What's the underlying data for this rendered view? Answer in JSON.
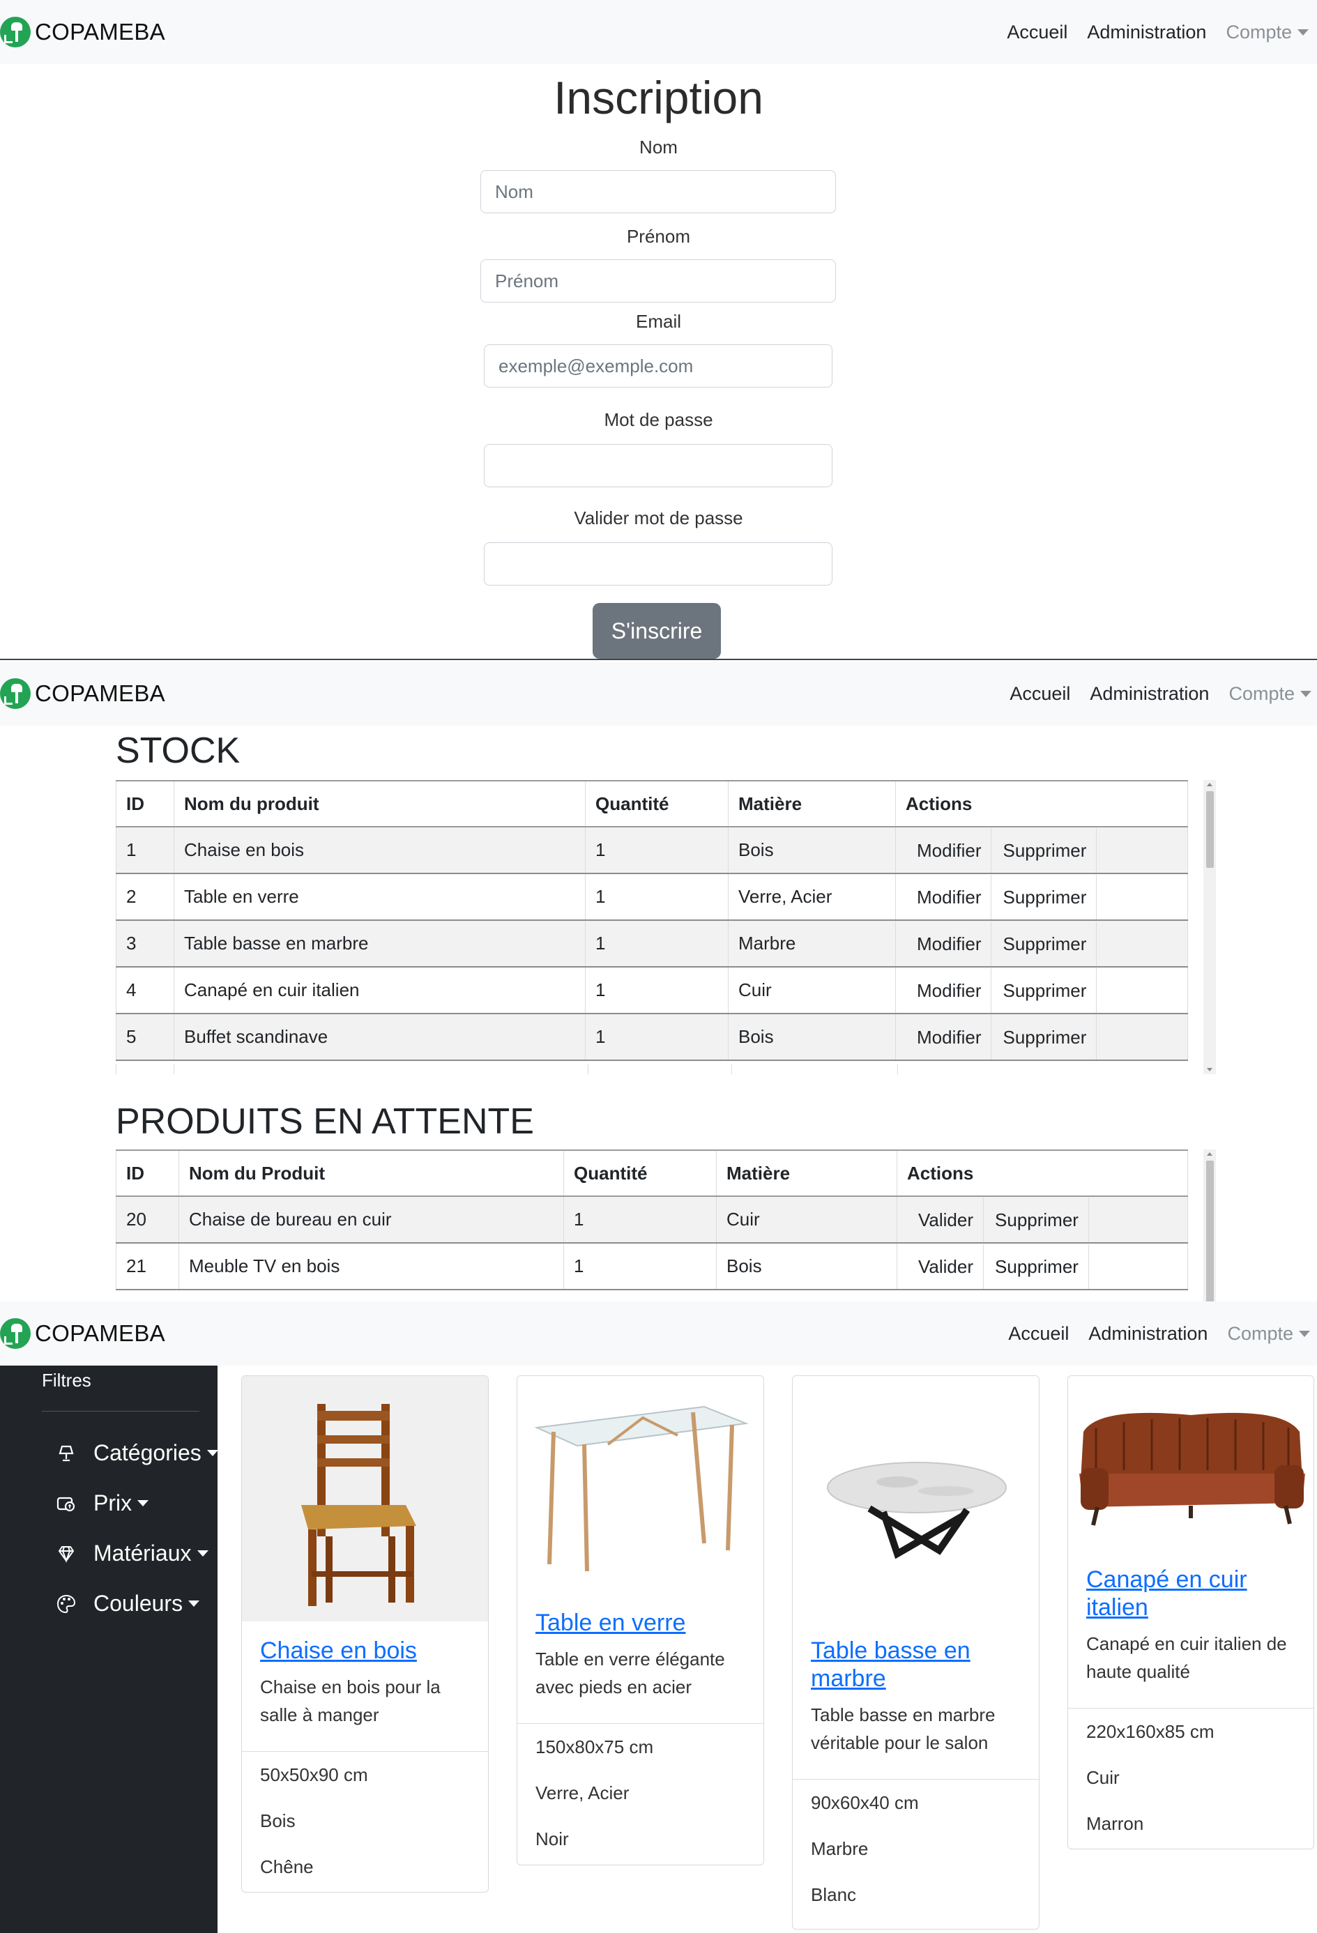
{
  "navbar": {
    "brand": "COPAMEBA",
    "links": {
      "home": "Accueil",
      "admin": "Administration",
      "account": "Compte"
    }
  },
  "inscription": {
    "title": "Inscription",
    "fields": {
      "nom": {
        "label": "Nom",
        "placeholder": "Nom"
      },
      "prenom": {
        "label": "Prénom",
        "placeholder": "Prénom"
      },
      "email": {
        "label": "Email",
        "placeholder": "exemple@exemple.com"
      },
      "password": {
        "label": "Mot de passe",
        "placeholder": ""
      },
      "confirm": {
        "label": "Valider mot de passe",
        "placeholder": ""
      }
    },
    "submit": "S'inscrire"
  },
  "stock": {
    "title": "STOCK",
    "headers": {
      "id": "ID",
      "name": "Nom du produit",
      "qty": "Quantité",
      "material": "Matière",
      "actions": "Actions"
    },
    "action_labels": {
      "edit": "Modifier",
      "delete": "Supprimer"
    },
    "rows": [
      {
        "id": "1",
        "name": "Chaise en bois",
        "qty": "1",
        "material": "Bois"
      },
      {
        "id": "2",
        "name": "Table en verre",
        "qty": "1",
        "material": "Verre, Acier"
      },
      {
        "id": "3",
        "name": "Table basse en marbre",
        "qty": "1",
        "material": "Marbre"
      },
      {
        "id": "4",
        "name": "Canapé en cuir italien",
        "qty": "1",
        "material": "Cuir"
      },
      {
        "id": "5",
        "name": "Buffet scandinave",
        "qty": "1",
        "material": "Bois"
      }
    ]
  },
  "pending": {
    "title": "PRODUITS EN ATTENTE",
    "headers": {
      "id": "ID",
      "name": "Nom du Produit",
      "qty": "Quantité",
      "material": "Matière",
      "actions": "Actions"
    },
    "action_labels": {
      "validate": "Valider",
      "delete": "Supprimer"
    },
    "rows": [
      {
        "id": "20",
        "name": "Chaise de bureau en cuir",
        "qty": "1",
        "material": "Cuir"
      },
      {
        "id": "21",
        "name": "Meuble TV en bois",
        "qty": "1",
        "material": "Bois"
      }
    ]
  },
  "catalog": {
    "sidebar": {
      "title": "Filtres",
      "items": {
        "categories": "Catégories",
        "price": "Prix",
        "materials": "Matériaux",
        "colors": "Couleurs"
      }
    },
    "products": [
      {
        "title": "Chaise en bois",
        "description": "Chaise en bois pour la salle à manger",
        "dimensions": "50x50x90 cm",
        "material": "Bois",
        "color": "Chêne"
      },
      {
        "title": "Table en verre",
        "description": "Table en verre élégante avec pieds en acier",
        "dimensions": "150x80x75 cm",
        "material": "Verre, Acier",
        "color": "Noir"
      },
      {
        "title": "Table basse en marbre",
        "description": "Table basse en marbre véritable pour le salon",
        "dimensions": "90x60x40 cm",
        "material": "Marbre",
        "color": "Blanc"
      },
      {
        "title": "Canapé en cuir italien",
        "description": "Canapé en cuir italien de haute qualité",
        "dimensions": "220x160x85 cm",
        "material": "Cuir",
        "color": "Marron"
      }
    ]
  },
  "colors": {
    "brand_green": "#23a455",
    "navbar_bg": "#f8f9fa",
    "link_blue": "#0d6efd",
    "sidebar_bg": "#212529",
    "button_gray": "#6c757d"
  },
  "icons": [
    "logo-icon",
    "chevron-down-icon",
    "lamp-icon",
    "price-tag-icon",
    "gem-icon",
    "palette-icon"
  ]
}
